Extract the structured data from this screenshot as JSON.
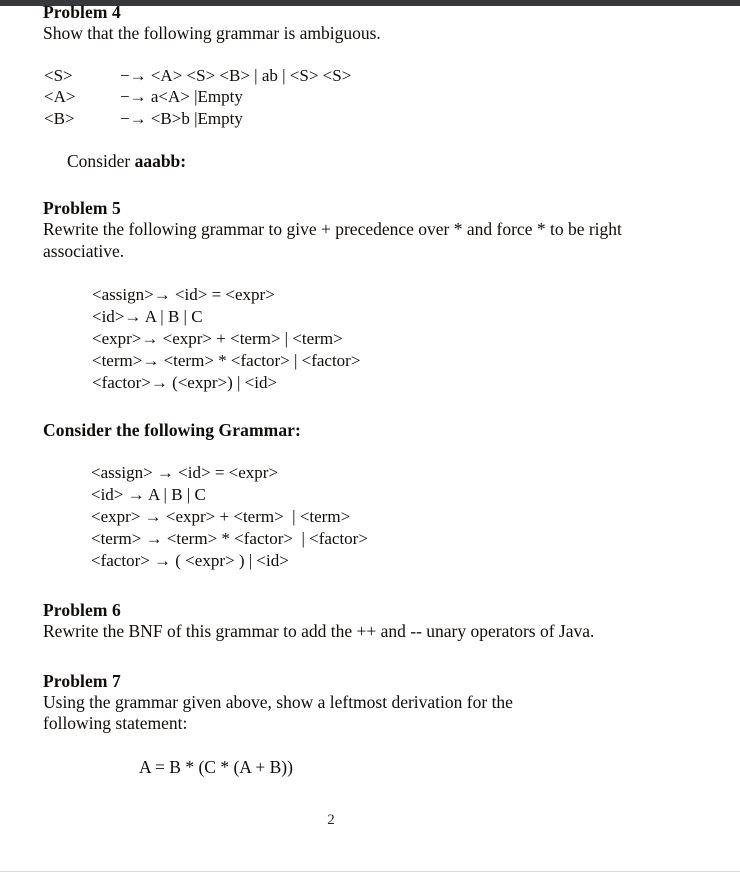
{
  "page": {
    "number": "2",
    "accent_bar_color": "#37393d",
    "rule_color": "#d9d9d9"
  },
  "problem4": {
    "heading": "Problem 4",
    "prompt": "Show that the following grammar is ambiguous.",
    "grammar": [
      {
        "lhs": "<S>",
        "rest": "−→ <A> <S> <B> | ab | <S> <S>"
      },
      {
        "lhs": "<A>",
        "rest": "−→ a<A> |Empty"
      },
      {
        "lhs": "<B>",
        "rest": "−→ <B>b |Empty"
      }
    ],
    "consider_label": "Consider ",
    "consider_value": "aaabb:"
  },
  "problem5": {
    "heading": "Problem 5",
    "prompt": "Rewrite the following grammar to give + precedence over * and force * to be right associative.",
    "grammar": [
      {
        "lhs": "<assign>",
        "rest": "→ <id> = <expr>"
      },
      {
        "lhs": "<id>",
        "rest": "→ A | B | C"
      },
      {
        "lhs": "<expr>",
        "rest": "→ <expr> + <term> | <term>"
      },
      {
        "lhs": "<term>",
        "rest": "→ <term> * <factor> | <factor>"
      },
      {
        "lhs": "<factor>",
        "rest": "→ (<expr>) | <id>"
      }
    ]
  },
  "consider_grammar": {
    "heading": "Consider the following Grammar:",
    "lines": [
      "<assign> → <id> = <expr>",
      "<id> → A | B | C",
      "<expr> → <expr> + <term>  | <term>",
      "<term> → <term> * <factor>  | <factor>",
      "<factor> → ( <expr> ) | <id>"
    ]
  },
  "problem6": {
    "heading": "Problem 6",
    "prompt": "Rewrite the BNF of this grammar to add the ++ and -- unary operators of Java."
  },
  "problem7": {
    "heading": "Problem 7",
    "prompt": "Using the grammar given above, show a leftmost derivation for the following statement:",
    "statement": "A = B * (C * (A + B))"
  }
}
